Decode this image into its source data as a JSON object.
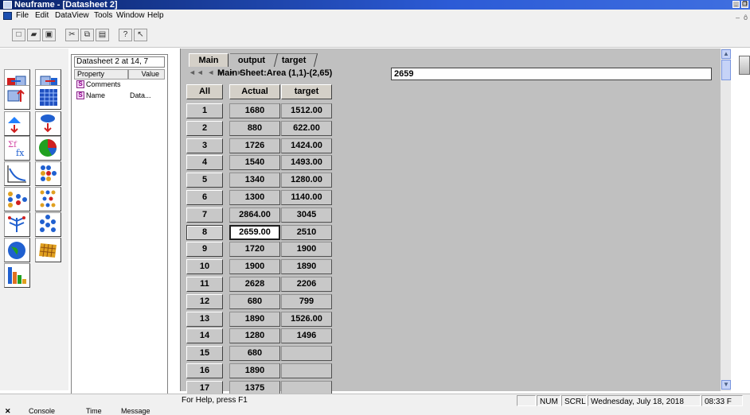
{
  "window": {
    "title": "Neuframe - [Datasheet 2]"
  },
  "menu": [
    "File",
    "Edit",
    "DataView",
    "Tools",
    "Window",
    "Help"
  ],
  "toolbar": {
    "buttons": [
      {
        "name": "new-file-icon",
        "glyph": "□"
      },
      {
        "name": "open-folder-icon",
        "glyph": "▰"
      },
      {
        "name": "save-icon",
        "glyph": "▣"
      },
      {
        "name": "cut-icon",
        "glyph": "✂"
      },
      {
        "name": "copy-icon",
        "glyph": "⧉"
      },
      {
        "name": "paste-icon",
        "glyph": "▤"
      },
      {
        "name": "about-icon",
        "glyph": "?"
      },
      {
        "name": "context-help-icon",
        "glyph": "↖"
      }
    ]
  },
  "palette": {
    "tools": [
      {
        "name": "input-node-icon",
        "color": "#d02020"
      },
      {
        "name": "output-node-icon",
        "color": "#2060d0"
      },
      {
        "name": "query-node-icon",
        "color": "#d02020"
      },
      {
        "name": "datasheet-node-icon",
        "color": "#2050c0"
      },
      {
        "name": "split-node-icon",
        "color": "#2080ff"
      },
      {
        "name": "filter-node-icon",
        "color": "#d02020"
      },
      {
        "name": "function-node-icon",
        "color": "#d040a0"
      },
      {
        "name": "pie-chart-node-icon",
        "color": "#20a020"
      },
      {
        "name": "graph-node-icon",
        "color": "#2060d0"
      },
      {
        "name": "cluster-node-icon",
        "color": "#e0a020"
      },
      {
        "name": "network-node-icon",
        "color": "#2060d0"
      },
      {
        "name": "layers-node-icon",
        "color": "#e0a020"
      },
      {
        "name": "tree-node-icon",
        "color": "#2060d0"
      },
      {
        "name": "som-node-icon",
        "color": "#2060d0"
      },
      {
        "name": "globe-node-icon",
        "color": "#2060d0"
      },
      {
        "name": "grid-node-icon",
        "color": "#e0a020"
      },
      {
        "name": "bar-chart-node-icon",
        "color": "#e07020"
      }
    ]
  },
  "properties": {
    "title": "Datasheet 2 at 14, 7",
    "headers": [
      "Property",
      "Value"
    ],
    "rows": [
      {
        "badge": "S",
        "name": "Comments",
        "value": ""
      },
      {
        "badge": "S",
        "name": "Name",
        "value": "Data..."
      }
    ]
  },
  "sheet": {
    "tabs": [
      "Main",
      "output",
      "target"
    ],
    "nav_arrows": "◄◄ ◄ ► ►►",
    "area_label": "Main Sheet:Area (1,1)-(2,65)",
    "cell_value": "2659",
    "all_label": "All",
    "columns": [
      "Actual",
      "target"
    ],
    "rows": [
      {
        "n": "1",
        "actual": "1680",
        "target": "1512.00"
      },
      {
        "n": "2",
        "actual": "880",
        "target": "622.00"
      },
      {
        "n": "3",
        "actual": "1726",
        "target": "1424.00"
      },
      {
        "n": "4",
        "actual": "1540",
        "target": "1493.00"
      },
      {
        "n": "5",
        "actual": "1340",
        "target": "1280.00"
      },
      {
        "n": "6",
        "actual": "1300",
        "target": "1140.00"
      },
      {
        "n": "7",
        "actual": "2864.00",
        "target": "3045"
      },
      {
        "n": "8",
        "actual": "2659.00",
        "target": "2510"
      },
      {
        "n": "9",
        "actual": "1720",
        "target": "1900"
      },
      {
        "n": "10",
        "actual": "1900",
        "target": "1890"
      },
      {
        "n": "11",
        "actual": "2628",
        "target": "2206"
      },
      {
        "n": "12",
        "actual": "680",
        "target": "799"
      },
      {
        "n": "13",
        "actual": "1890",
        "target": "1526.00"
      },
      {
        "n": "14",
        "actual": "1280",
        "target": "1496"
      },
      {
        "n": "15",
        "actual": "680",
        "target": ""
      },
      {
        "n": "16",
        "actual": "1890",
        "target": ""
      },
      {
        "n": "17",
        "actual": "1375",
        "target": ""
      }
    ],
    "selected_row": "8"
  },
  "status": {
    "help": "For Help, press F1",
    "num": "NUM",
    "scrl": "SCRL",
    "datetime": "Wednesday, July 18, 2018",
    "time": "08:33 F"
  },
  "bottom_tabs": [
    "Console",
    "Time",
    "Message"
  ]
}
